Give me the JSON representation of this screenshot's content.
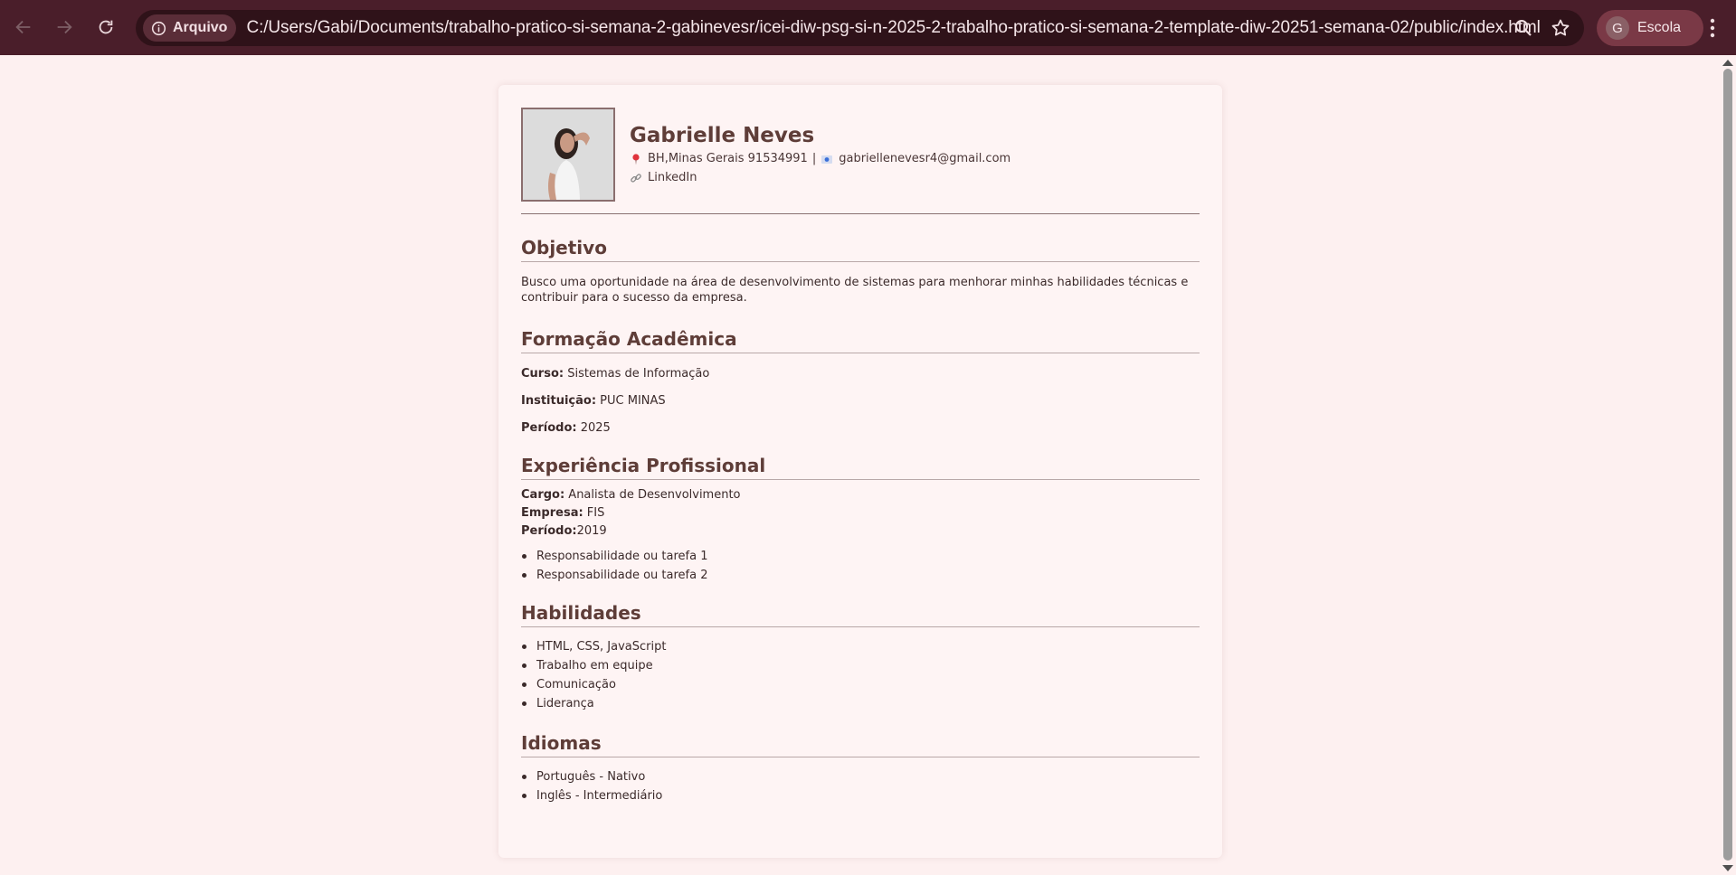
{
  "browser": {
    "chip_label": "Arquivo",
    "url": "C:/Users/Gabi/Documents/trabalho-pratico-si-semana-2-gabinevesr/icei-diw-psg-si-n-2025-2-trabalho-pratico-si-semana-2-template-diw-20251-semana-02/public/index.html",
    "profile_initial": "G",
    "profile_name": "Escola",
    "icons": [
      "back-icon",
      "forward-icon",
      "reload-icon",
      "info-icon",
      "zoom-icon",
      "star-icon",
      "menu-icon"
    ]
  },
  "resume": {
    "name": "Gabrielle Neves",
    "location": "BH,Minas Gerais 91534991",
    "separator": "|",
    "email": "gabriellenevesr4@gmail.com",
    "linkedin": "LinkedIn",
    "objective": {
      "title": "Objetivo",
      "text": "Busco uma oportunidade na área de desenvolvimento de sistemas para menhorar minhas habilidades técnicas e contribuir para o sucesso da empresa."
    },
    "education": {
      "title": "Formação Acadêmica",
      "course_label": "Curso:",
      "course_value": " Sistemas de Informação",
      "institution_label": "Instituição:",
      "institution_value": " PUC MINAS",
      "period_label": "Período:",
      "period_value": " 2025"
    },
    "experience": {
      "title": "Experiência Profissional",
      "role_label": "Cargo:",
      "role_value": " Analista de Desenvolvimento",
      "company_label": "Empresa:",
      "company_value": " FIS",
      "period_label": "Período:",
      "period_value": "2019",
      "tasks": [
        "Responsabilidade ou tarefa 1",
        "Responsabilidade ou tarefa 2"
      ]
    },
    "skills": {
      "title": "Habilidades",
      "items": [
        "HTML, CSS, JavaScript",
        "Trabalho em equipe",
        "Comunicação",
        "Liderança"
      ]
    },
    "languages": {
      "title": "Idiomas",
      "items": [
        "Português - Nativo",
        "Inglês - Intermediário"
      ]
    }
  }
}
